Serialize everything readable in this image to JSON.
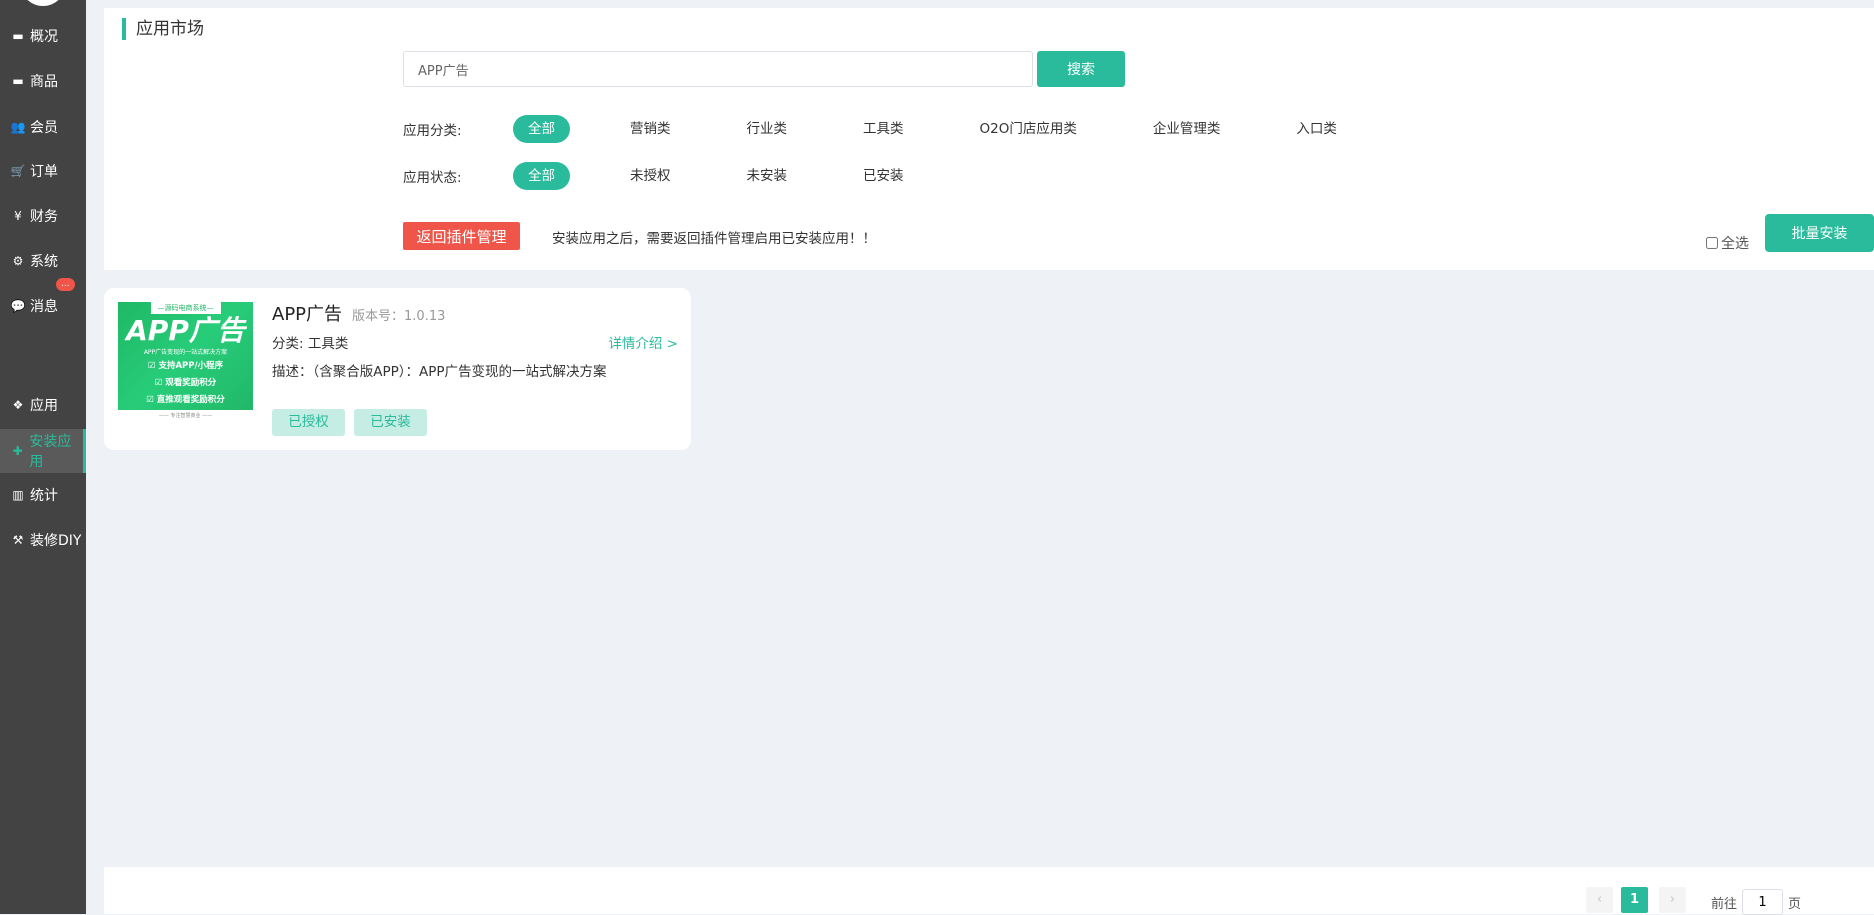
{
  "sidebar": {
    "items": [
      {
        "label": "概况",
        "icon": "archive-icon"
      },
      {
        "label": "商品",
        "icon": "archive-icon"
      },
      {
        "label": "会员",
        "icon": "users-icon"
      },
      {
        "label": "订单",
        "icon": "cart-icon"
      },
      {
        "label": "财务",
        "icon": "yen-icon"
      },
      {
        "label": "系统",
        "icon": "gears-icon"
      },
      {
        "label": "消息",
        "icon": "comment-icon",
        "badge": "..."
      },
      {
        "label": "应用",
        "icon": "cubes-icon"
      },
      {
        "label": "安装应用",
        "icon": "puzzle-icon",
        "active": true
      },
      {
        "label": "统计",
        "icon": "bar-chart-icon"
      },
      {
        "label": "装修DIY",
        "icon": "hammer-icon"
      }
    ]
  },
  "header": {
    "title": "应用市场",
    "search_value": "APP广告",
    "search_label": "搜索"
  },
  "filters": {
    "category_label": "应用分类:",
    "categories": [
      "全部",
      "营销类",
      "行业类",
      "工具类",
      "O2O门店应用类",
      "企业管理类",
      "入口类"
    ],
    "status_label": "应用状态:",
    "statuses": [
      "全部",
      "未授权",
      "未安装",
      "已安装"
    ]
  },
  "actions": {
    "back_label": "返回插件管理",
    "notice": "安装应用之后，需要返回插件管理启用已安装应用！！",
    "select_all": "全选",
    "batch_install": "批量安装"
  },
  "card": {
    "name": "APP广告",
    "version": "版本号：1.0.13",
    "category": "分类: 工具类",
    "detail": "详情介绍 >",
    "desc": "描述：（含聚合版APP）：APP广告变现的一站式解决方案",
    "tags": [
      "已授权",
      "已安装"
    ],
    "thumb": {
      "top": "—源码电商系统—",
      "title": "APP广告",
      "sub": "APP广告变现的一站式解决方案",
      "lines": [
        "☑ 支持APP/小程序",
        "☑ 观看奖励积分",
        "☑ 直推观看奖励积分"
      ],
      "foot": "—— 专注智慧商业 ——"
    }
  },
  "pagination": {
    "current": "1",
    "goto_label": "前往",
    "goto_value": "1",
    "page_suffix": "页"
  },
  "colors": {
    "accent": "#29bb9c",
    "danger": "#ef5548",
    "sidebar": "#434343"
  }
}
